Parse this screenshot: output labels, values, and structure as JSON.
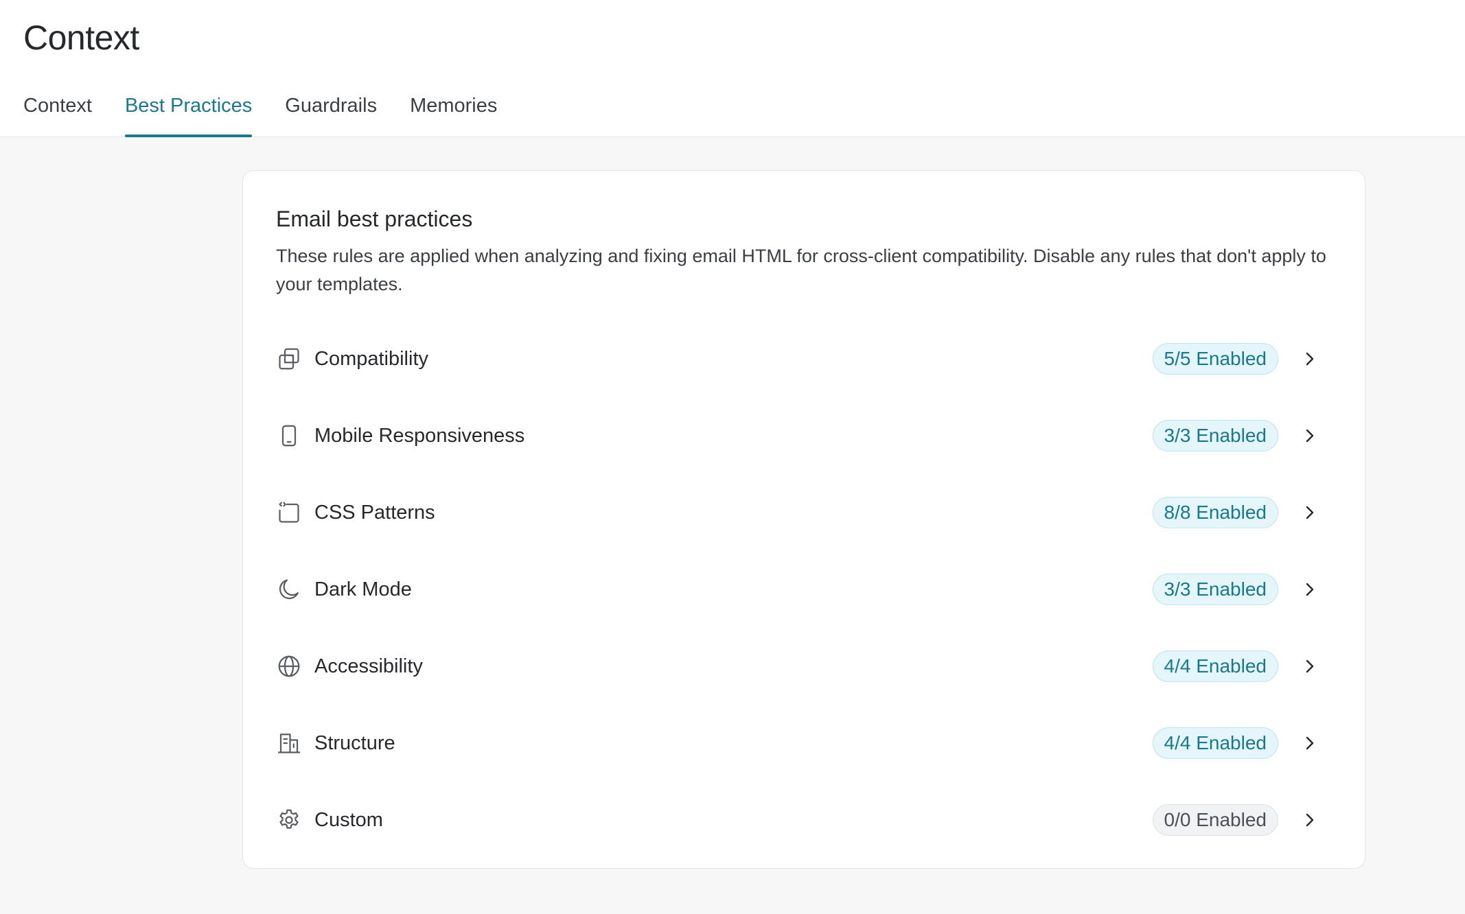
{
  "page": {
    "title": "Context"
  },
  "tabs": [
    {
      "label": "Context",
      "active": false
    },
    {
      "label": "Best Practices",
      "active": true
    },
    {
      "label": "Guardrails",
      "active": false
    },
    {
      "label": "Memories",
      "active": false
    }
  ],
  "card": {
    "title": "Email best practices",
    "description": "These rules are applied when analyzing and fixing email HTML for cross-client compatibility. Disable any rules that don't apply to your templates."
  },
  "rules": [
    {
      "label": "Compatibility",
      "icon": "copy-icon",
      "badge": "5/5 Enabled",
      "enabled": 5,
      "total": 5
    },
    {
      "label": "Mobile Responsiveness",
      "icon": "phone-icon",
      "badge": "3/3 Enabled",
      "enabled": 3,
      "total": 3
    },
    {
      "label": "CSS Patterns",
      "icon": "code-frame-icon",
      "badge": "8/8 Enabled",
      "enabled": 8,
      "total": 8
    },
    {
      "label": "Dark Mode",
      "icon": "moon-icon",
      "badge": "3/3 Enabled",
      "enabled": 3,
      "total": 3
    },
    {
      "label": "Accessibility",
      "icon": "globe-icon",
      "badge": "4/4 Enabled",
      "enabled": 4,
      "total": 4
    },
    {
      "label": "Structure",
      "icon": "building-icon",
      "badge": "4/4 Enabled",
      "enabled": 4,
      "total": 4
    },
    {
      "label": "Custom",
      "icon": "gear-icon",
      "badge": "0/0 Enabled",
      "enabled": 0,
      "total": 0
    }
  ],
  "colors": {
    "accent": "#1a7891",
    "badge_bg": "#e5f6fa",
    "badge_muted_bg": "#f1f2f4",
    "page_bg": "#f7f7f8"
  }
}
